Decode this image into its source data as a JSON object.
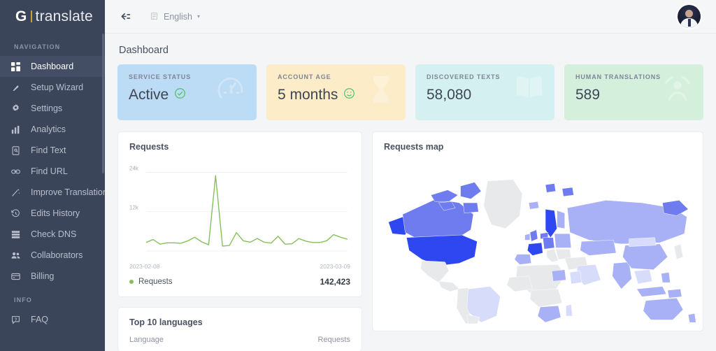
{
  "sidebar": {
    "logo": {
      "bold": "G",
      "rest": "translate"
    },
    "sections": [
      {
        "label": "NAVIGATION"
      },
      {
        "label": "INFO"
      }
    ],
    "items": [
      {
        "label": "Dashboard",
        "icon": "grid-icon",
        "active": true
      },
      {
        "label": "Setup Wizard",
        "icon": "wand-icon",
        "active": false
      },
      {
        "label": "Settings",
        "icon": "gear-icon",
        "active": false
      },
      {
        "label": "Analytics",
        "icon": "bar-chart-icon",
        "active": false
      },
      {
        "label": "Find Text",
        "icon": "document-icon",
        "active": false
      },
      {
        "label": "Find URL",
        "icon": "link-icon",
        "active": false
      },
      {
        "label": "Improve Translations",
        "icon": "magic-wand-icon",
        "active": false
      },
      {
        "label": "Edits History",
        "icon": "clock-icon",
        "active": false
      },
      {
        "label": "Check DNS",
        "icon": "server-icon",
        "active": false
      },
      {
        "label": "Collaborators",
        "icon": "users-icon",
        "active": false
      },
      {
        "label": "Billing",
        "icon": "card-icon",
        "active": false
      }
    ],
    "info_items": [
      {
        "label": "FAQ",
        "icon": "faq-icon",
        "active": false
      }
    ]
  },
  "topbar": {
    "collapse_icon": "collapse-left-icon",
    "language": "English",
    "flag_icon": "flag-icon",
    "caret": "▾",
    "avatar_icon": "user-avatar"
  },
  "page": {
    "title": "Dashboard"
  },
  "cards": [
    {
      "caption": "SERVICE STATUS",
      "value": "Active",
      "badge": "✓",
      "bg": "#bcdcf5",
      "watermark": "speedometer-icon"
    },
    {
      "caption": "ACCOUNT AGE",
      "value": "5 months",
      "badge": "☺",
      "bg": "#fcecc8",
      "watermark": "hourglass-icon"
    },
    {
      "caption": "DISCOVERED TEXTS",
      "value": "58,080",
      "badge": "",
      "bg": "#d4f0f0",
      "watermark": "book-icon"
    },
    {
      "caption": "HUMAN TRANSLATIONS",
      "value": "589",
      "badge": "",
      "bg": "#d4f0dd",
      "watermark": "person-icon"
    }
  ],
  "requests_panel": {
    "title": "Requests",
    "legend_label": "Requests",
    "legend_value": "142,423",
    "legend_color": "#85c15a"
  },
  "languages_panel": {
    "title": "Top 10 languages",
    "col_language": "Language",
    "col_requests": "Requests"
  },
  "map_panel": {
    "title": "Requests map",
    "colors": {
      "no_data": "#e8e9eb",
      "low": "#d8dcfb",
      "mid": "#a8b0f6",
      "high": "#6f7cf0",
      "top": "#2f47f0"
    }
  },
  "chart_data": {
    "type": "line",
    "title": "Requests",
    "xlabel": "",
    "ylabel": "",
    "x_start": "2023-02-08",
    "x_end": "2023-03-09",
    "ylim": [
      0,
      26000
    ],
    "yticks": [
      12000,
      24000
    ],
    "ytick_labels": [
      "12k",
      "24k"
    ],
    "grid": true,
    "legend_position": "bottom",
    "series": [
      {
        "name": "Requests",
        "color": "#85c15a",
        "total": "142,423",
        "x": [
          "2023-02-08",
          "2023-02-09",
          "2023-02-10",
          "2023-02-11",
          "2023-02-12",
          "2023-02-13",
          "2023-02-14",
          "2023-02-15",
          "2023-02-16",
          "2023-02-17",
          "2023-02-18",
          "2023-02-19",
          "2023-02-20",
          "2023-02-21",
          "2023-02-22",
          "2023-02-23",
          "2023-02-24",
          "2023-02-25",
          "2023-02-26",
          "2023-02-27",
          "2023-02-28",
          "2023-03-01",
          "2023-03-02",
          "2023-03-03",
          "2023-03-04",
          "2023-03-05",
          "2023-03-06",
          "2023-03-07",
          "2023-03-08",
          "2023-03-09"
        ],
        "values": [
          2600,
          3500,
          2100,
          2500,
          2500,
          2350,
          3100,
          4200,
          2800,
          1900,
          23000,
          1500,
          1700,
          5600,
          3100,
          2700,
          3800,
          2700,
          2400,
          4500,
          2100,
          2200,
          3800,
          3000,
          2600,
          2600,
          3100,
          5000,
          4200,
          3600
        ]
      }
    ]
  }
}
